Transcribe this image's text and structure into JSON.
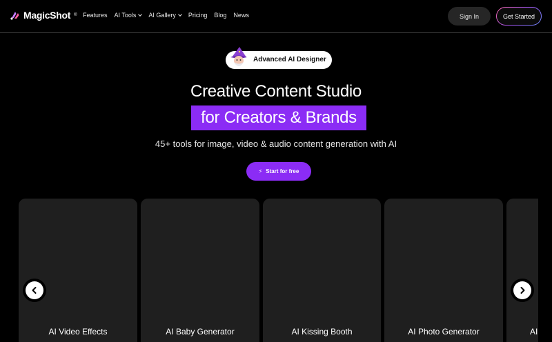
{
  "brand": {
    "name": "MagicShot",
    "reg": "®",
    "accent": "#8b2cf5"
  },
  "nav": {
    "items": [
      {
        "label": "Features",
        "dropdown": false
      },
      {
        "label": "AI Tools",
        "dropdown": true
      },
      {
        "label": "AI Gallery",
        "dropdown": true
      },
      {
        "label": "Pricing",
        "dropdown": false
      },
      {
        "label": "Blog",
        "dropdown": false
      },
      {
        "label": "News",
        "dropdown": false
      }
    ],
    "signin_label": "Sign In",
    "get_started_label": "Get Started"
  },
  "hero": {
    "badge": "Advanced AI Designer",
    "title": "Creative Content Studio",
    "title_highlight": "for Creators & Brands",
    "subtitle": "45+ tools for image, video & audio content generation with AI",
    "cta_label": "Start for free",
    "cta_icon": "lightning-icon"
  },
  "carousel": {
    "cards": [
      {
        "title": "AI Video Effects"
      },
      {
        "title": "AI Baby Generator"
      },
      {
        "title": "AI Kissing Booth"
      },
      {
        "title": "AI Photo Generator"
      },
      {
        "title": "AI"
      }
    ],
    "prev_icon": "chevron-left-icon",
    "next_icon": "chevron-right-icon"
  }
}
